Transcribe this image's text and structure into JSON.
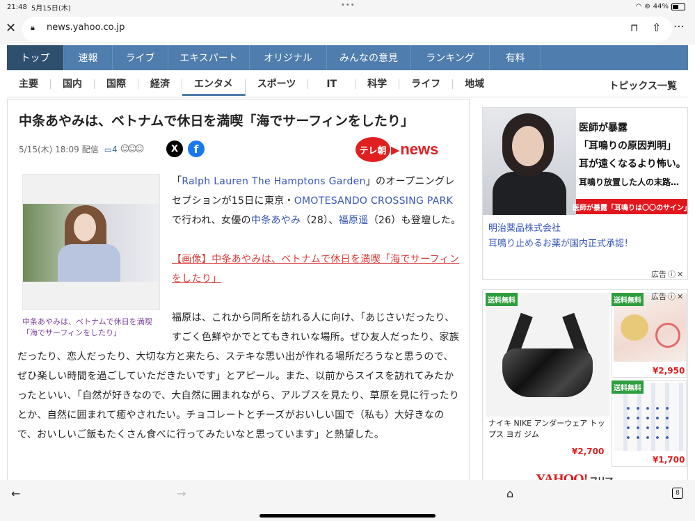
{
  "status": {
    "time": "21:48",
    "date": "5月15日(木)",
    "battery": "44%",
    "battery_level": 0.44
  },
  "browser": {
    "url": "news.yahoo.co.jp"
  },
  "global_nav": [
    "トップ",
    "速報",
    "ライブ",
    "エキスパート",
    "オリジナル",
    "みんなの意見",
    "ランキング",
    "有料"
  ],
  "global_nav_active": "トップ",
  "sub_nav": [
    "主要",
    "国内",
    "国際",
    "経済",
    "エンタメ",
    "スポーツ",
    "IT",
    "科学",
    "ライフ",
    "地域"
  ],
  "sub_nav_active": "エンタメ",
  "sub_nav_topics": "トピックス一覧",
  "article": {
    "title": "中条あやみは、ベトナムで休日を満喫「海でサーフィンをしたり」",
    "date": "5/15(木) 18:09",
    "date_suffix": "配信",
    "comment_count": "4",
    "logo_circle": "テレ朝",
    "logo_text": "news",
    "caption": "中条あやみは、ベトナムで休日を満喫「海でサーフィンをしたり」",
    "p1": {
      "t1": "「",
      "l1": "Ralph Lauren The Hamptons Garden",
      "t2": "」のオープニングレセプションが15日に東京・",
      "l2": "OMOTESANDO CROSSING PARK",
      "t3": "で行われ、女優の",
      "l3": "中条あやみ",
      "t4": "（28）、",
      "l4": "福原遥",
      "t5": "（26）も登壇した。"
    },
    "image_link": "【画像】中条あやみは、ベトナムで休日を満喫「海でサーフィンをしたり」",
    "p2": "福原は、これから同所を訪れる人に向け、「あじさいだったり、すごく色鮮やかでとてもきれいな場所。ぜひ友人だったり、家族だったり、恋人だったり、大切な方と来たら、ステキな思い出が作れる場所だろうなと思うので、ぜひ楽しい時間を過ごしていただきたいです」とアピール。また、以前からスイスを訪れてみたかったといい、「自然が好きなので、大自然に囲まれながら、アルプスを見たり、草原を見に行ったりとか、自然に囲まれて癒やされたい。チョコレートとチーズがおいしい国で（私も）大好きなので、おいしいご飯もたくさん食べに行ってみたいなと思っています」と熱望した。"
  },
  "ad1": {
    "lines": [
      "医師が暴露",
      "「耳鳴りの原因判明」",
      "耳が遠くなるより怖い。",
      "耳鳴り放置した人の末路…"
    ],
    "band": "医師が暴露「耳鳴りは〇〇のサイン」",
    "sponsor": "明治薬品株式会社",
    "headline": "耳鳴り止めるお薬が国内正式承認！",
    "label": "広告"
  },
  "ad2": {
    "label": "広告",
    "tag": "送料無料",
    "main_title": "ナイキ NIKE アンダーウェア トップス ヨガ ジム",
    "main_price": "¥2,700",
    "tile1_price": "¥2,950",
    "tile2_price": "¥1,700",
    "yahoo": "YAHOO!",
    "yahoo_suffix": "フリマ"
  }
}
